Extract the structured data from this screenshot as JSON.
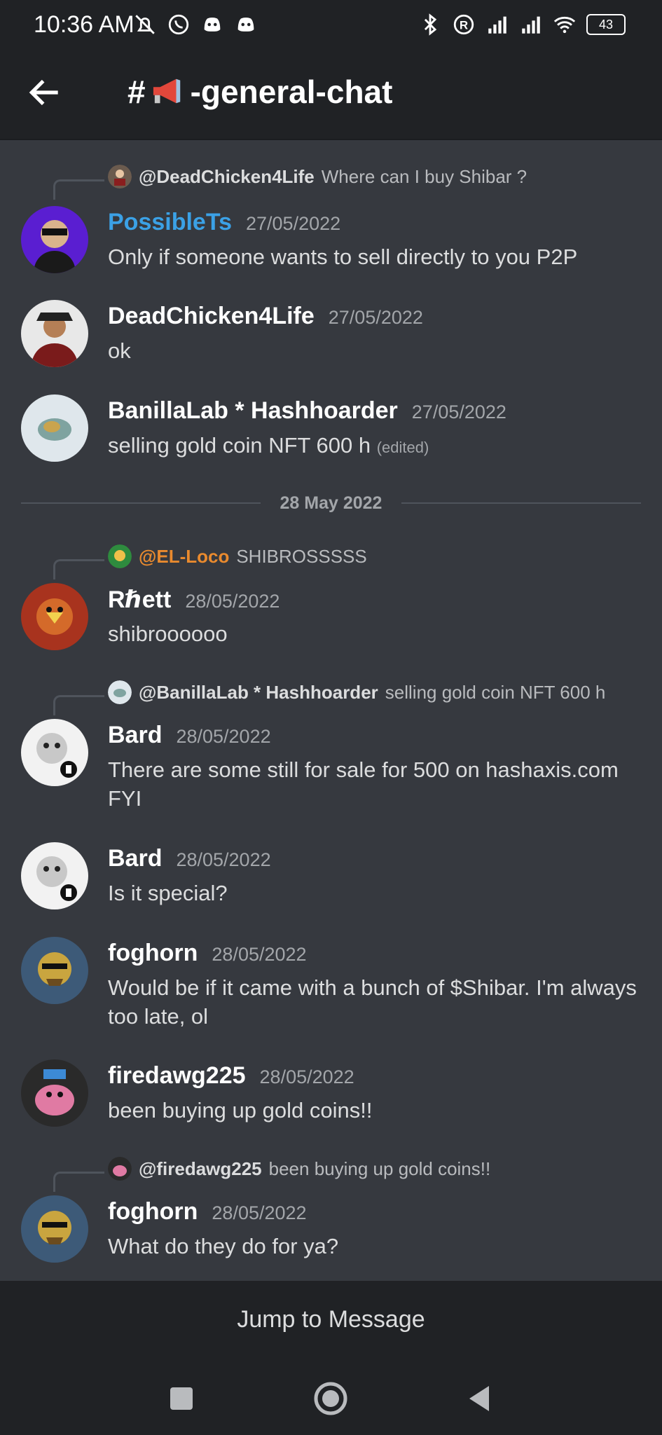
{
  "status_bar": {
    "time": "10:36 AM",
    "battery": "43"
  },
  "header": {
    "hash": "#",
    "channel_suffix": "-general-chat"
  },
  "messages": [
    {
      "reply": {
        "name": "@DeadChicken4Life",
        "text": "Where can I buy Shibar ?"
      },
      "author": "PossibleTs",
      "author_color": "#3ba1e6",
      "timestamp": "27/05/2022",
      "text": "Only if someone wants to sell directly to you P2P"
    },
    {
      "author": "DeadChicken4Life",
      "author_color": "#ffffff",
      "timestamp": "27/05/2022",
      "text": "ok"
    },
    {
      "author": "BanillaLab * Hashhoarder",
      "author_color": "#ffffff",
      "timestamp": "27/05/2022",
      "text": "selling gold coin NFT 600 h",
      "edited": "(edited)"
    },
    {
      "reply": {
        "name": "@EL-Loco",
        "name_color": "#e98a2e",
        "text": "SHIBROSSSSS"
      },
      "author": "Rℏett",
      "author_color": "#ffffff",
      "timestamp": "28/05/2022",
      "text": "shibroooooo"
    },
    {
      "reply": {
        "name": "@BanillaLab * Hashhoarder",
        "text": "selling gold coin NFT 600 h"
      },
      "author": "Bard",
      "author_color": "#ffffff",
      "timestamp": "28/05/2022",
      "text": "There are some still for sale for 500 on hashaxis.com FYI"
    },
    {
      "author": "Bard",
      "author_color": "#ffffff",
      "timestamp": "28/05/2022",
      "text": "Is it special?"
    },
    {
      "author": "foghorn",
      "author_color": "#ffffff",
      "timestamp": "28/05/2022",
      "text": "Would be if it came with a bunch of $Shibar. I'm always too late, ol"
    },
    {
      "author": "firedawg225",
      "author_color": "#ffffff",
      "timestamp": "28/05/2022",
      "text": "been buying up gold coins!!"
    },
    {
      "reply": {
        "name": "@firedawg225",
        "text": "been buying up gold coins!!"
      },
      "author": "foghorn",
      "author_color": "#ffffff",
      "timestamp": "28/05/2022",
      "text": "What do they do for ya?"
    }
  ],
  "date_divider": "28 May 2022",
  "jump_label": "Jump to Message"
}
